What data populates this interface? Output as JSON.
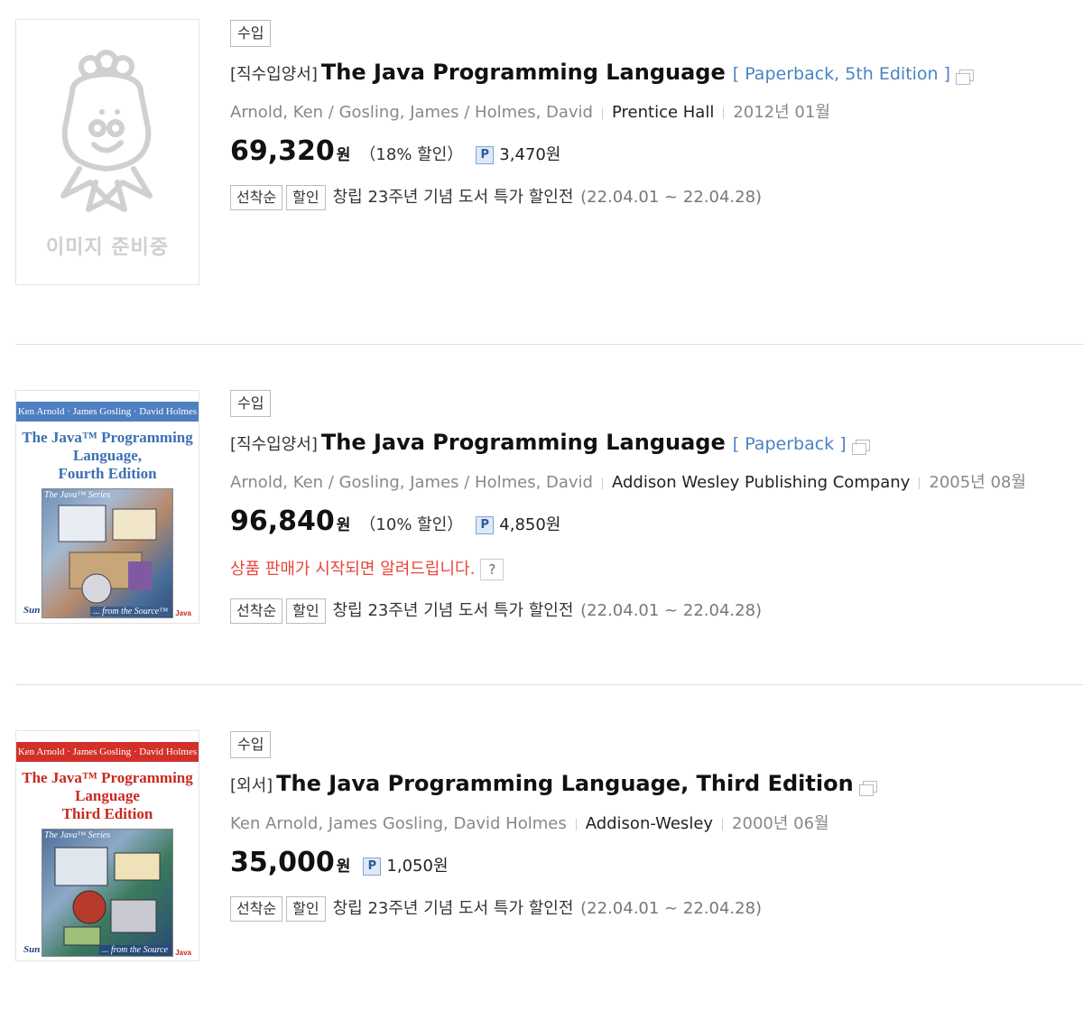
{
  "items": [
    {
      "cover": {
        "type": "placeholder",
        "placeholder_text": "이미지 준비중"
      },
      "import_badge": "수입",
      "prefix": "[직수입양서]",
      "title": "The Java Programming Language",
      "format": "[ Paperback, 5th Edition ]",
      "authors": "Arnold, Ken / Gosling, James / Holmes, David",
      "publisher": "Prentice Hall",
      "date": "2012년 01월",
      "price": "69,320",
      "currency": "원",
      "discount": "（18% 할인）",
      "points_icon": "P",
      "points": "3,470원",
      "tags": [
        "선착순",
        "할인"
      ],
      "event": "창립 23주년 기념 도서 특가 할인전",
      "event_period": "(22.04.01 ~ 22.04.28)"
    },
    {
      "cover": {
        "type": "book",
        "authors_band": "Ken Arnold · James Gosling · David Holmes",
        "title_lines": [
          "The Java™ Programming",
          "Language,",
          "Fourth Edition"
        ],
        "series": "The Java™ Series",
        "source": "... from the Source™",
        "logo": "Sun",
        "java_logo": "Java",
        "band_color": "#4e7fc0",
        "title_color": "#3c6fb2"
      },
      "import_badge": "수입",
      "prefix": "[직수입양서]",
      "title": "The Java Programming Language",
      "format": "[ Paperback ]",
      "authors": "Arnold, Ken / Gosling, James / Holmes, David",
      "publisher": "Addison Wesley Publishing Company",
      "date": "2005년 08월",
      "price": "96,840",
      "currency": "원",
      "discount": "（10% 할인）",
      "points_icon": "P",
      "points": "4,850원",
      "notify": "상품 판매가 시작되면 알려드립니다.",
      "notify_help": "?",
      "tags": [
        "선착순",
        "할인"
      ],
      "event": "창립 23주년 기념 도서 특가 할인전",
      "event_period": "(22.04.01 ~ 22.04.28)"
    },
    {
      "cover": {
        "type": "book",
        "authors_band": "Ken Arnold · James Gosling · David Holmes",
        "title_lines": [
          "The Java™ Programming",
          "Language",
          "Third Edition"
        ],
        "series": "The Java™ Series",
        "source": "... from the Source",
        "logo": "Sun",
        "java_logo": "Java",
        "band_color": "#d3302a",
        "title_color": "#c9281f"
      },
      "import_badge": "수입",
      "prefix": "[외서]",
      "title": "The Java Programming Language, Third Edition",
      "format": "",
      "authors": "Ken Arnold, James Gosling, David Holmes",
      "publisher": "Addison-Wesley",
      "date": "2000년 06월",
      "price": "35,000",
      "currency": "원",
      "points_icon": "P",
      "points": "1,050원",
      "tags": [
        "선착순",
        "할인"
      ],
      "event": "창립 23주년 기념 도서 특가 할인전",
      "event_period": "(22.04.01 ~ 22.04.28)"
    }
  ]
}
